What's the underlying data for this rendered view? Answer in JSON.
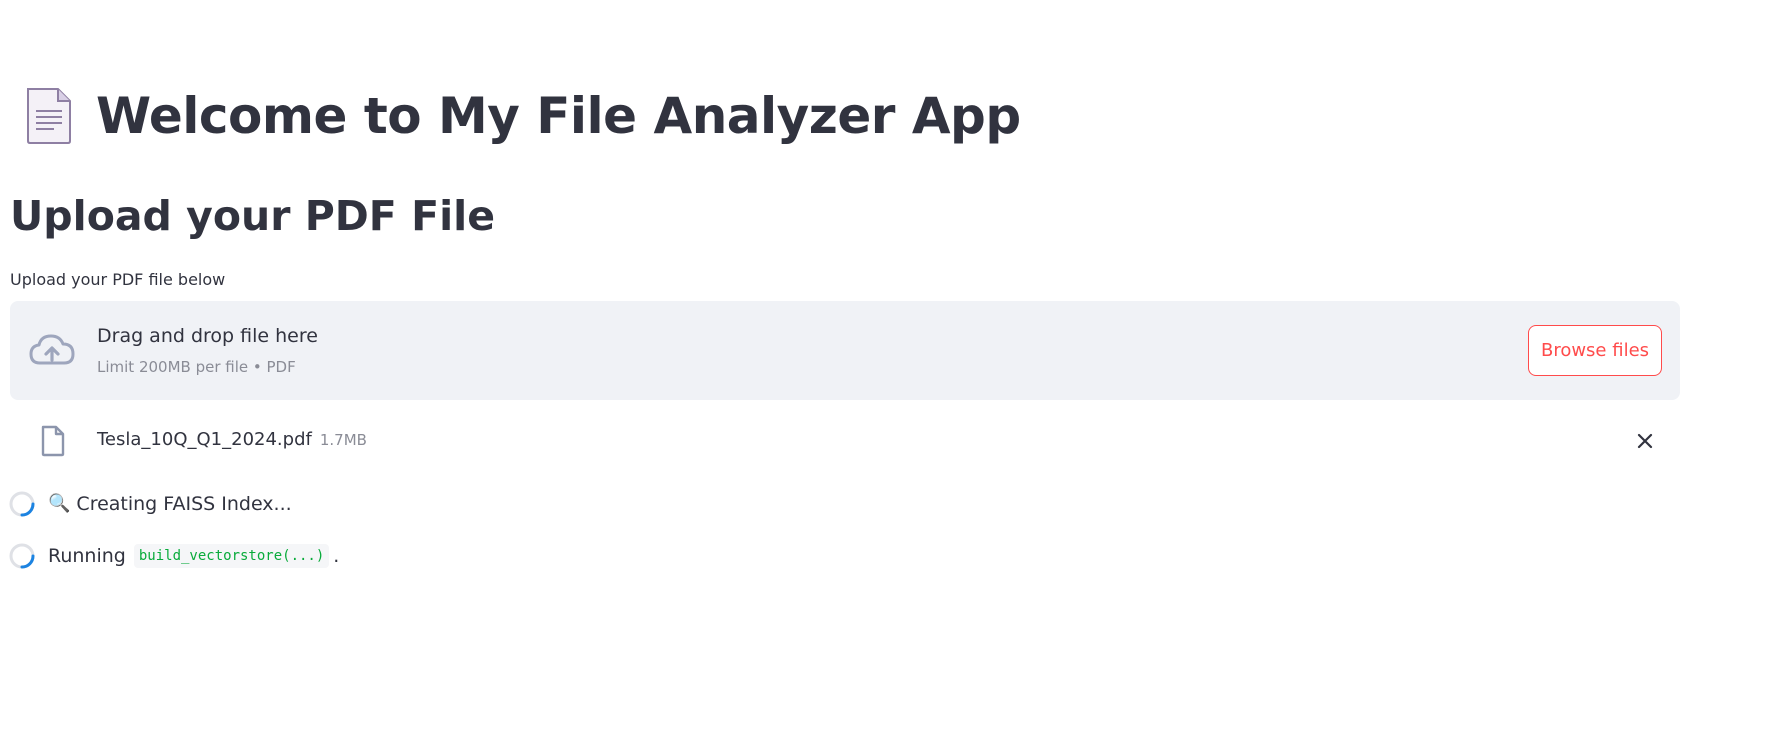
{
  "header": {
    "title": "Welcome to My File Analyzer App",
    "icon": "page-facing-up-icon"
  },
  "main": {
    "subheader": "Upload your PDF File",
    "uploader": {
      "label": "Upload your PDF file below",
      "dropzone_text": "Drag and drop file here",
      "limit_text": "Limit 200MB per file • PDF",
      "browse_label": "Browse files",
      "accent_color": "#ff4b4b"
    },
    "uploaded_file": {
      "name": "Tesla_10Q_Q1_2024.pdf",
      "size": "1.7MB"
    },
    "status": [
      {
        "emoji": "🔍",
        "text": "Creating FAISS Index..."
      },
      {
        "prefix": "Running",
        "code": "build_vectorstore(...)",
        "suffix": "."
      }
    ]
  }
}
